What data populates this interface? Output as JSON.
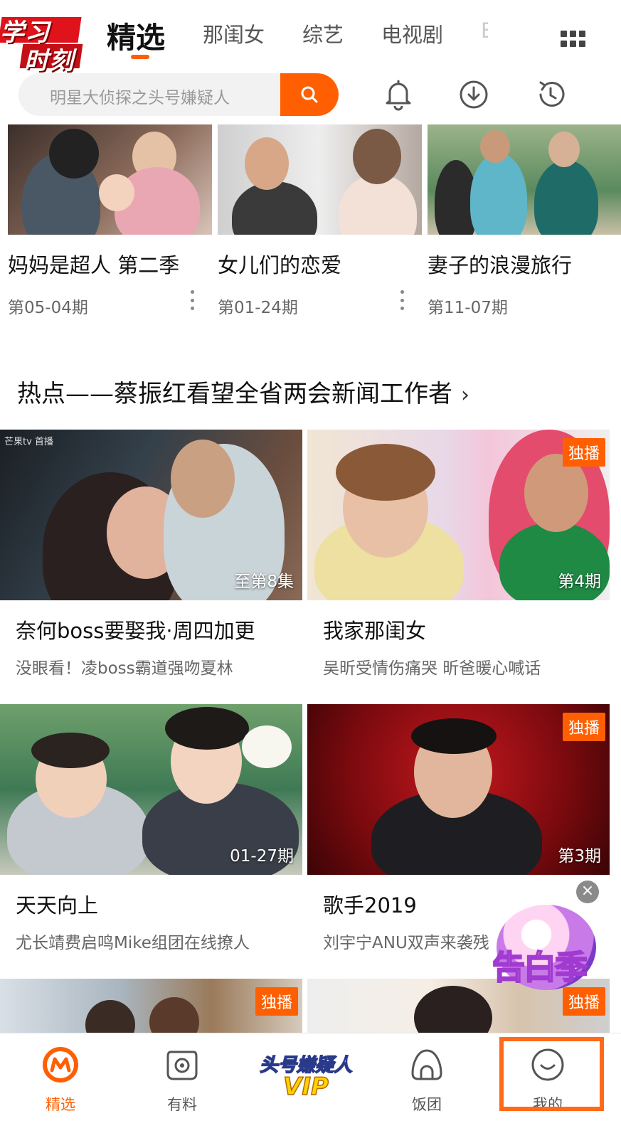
{
  "header": {
    "logo_line1": "学习",
    "logo_line2": "时刻",
    "tabs": [
      {
        "label": "精选"
      },
      {
        "label": "那闺女"
      },
      {
        "label": "综艺"
      },
      {
        "label": "电视剧"
      },
      {
        "label": "E"
      }
    ]
  },
  "search": {
    "placeholder": "明星大侦探之头号嫌疑人"
  },
  "recent_row": [
    {
      "title": "妈妈是超人 第二季",
      "episode": "第05-04期"
    },
    {
      "title": "女儿们的恋爱",
      "episode": "第01-24期"
    },
    {
      "title": "妻子的浪漫旅行",
      "episode": "第11-07期"
    }
  ],
  "section": {
    "title": "热点——蔡振红看望全省两会新闻工作者",
    "arrow": "›"
  },
  "cards": [
    {
      "title": "奈何boss要娶我·周四加更",
      "subtitle": "没眼看！凌boss霸道强吻夏林",
      "corner": "至第8集",
      "badge": "",
      "watermark": "芒果tv 首播"
    },
    {
      "title": "我家那闺女",
      "subtitle": "吴昕受情伤痛哭 昕爸暖心喊话",
      "corner": "第4期",
      "badge": "独播",
      "watermark": ""
    },
    {
      "title": "天天向上",
      "subtitle": "尤长靖费启鸣Mike组团在线撩人",
      "corner": "01-27期",
      "badge": "",
      "watermark": ""
    },
    {
      "title": "歌手2019",
      "subtitle": "刘宇宁ANU双声来袭残",
      "corner": "第3期",
      "badge": "独播",
      "watermark": ""
    },
    {
      "title": "",
      "subtitle": "",
      "corner": "",
      "badge": "独播",
      "watermark": ""
    },
    {
      "title": "",
      "subtitle": "",
      "corner": "",
      "badge": "独播",
      "watermark": ""
    }
  ],
  "promo": {
    "text": "告白季",
    "close": "×"
  },
  "bottom_nav": [
    {
      "label": "精选",
      "icon": "mango-logo-icon"
    },
    {
      "label": "有料",
      "icon": "swirl-icon"
    },
    {
      "label": "VIP",
      "banner": "头号嫌疑人",
      "icon": "vip-banner-icon"
    },
    {
      "label": "饭团",
      "icon": "rice-ball-icon"
    },
    {
      "label": "我的",
      "icon": "smile-face-icon"
    }
  ],
  "colors": {
    "accent": "#ff5f00",
    "highlight": "#ff6a1a"
  }
}
